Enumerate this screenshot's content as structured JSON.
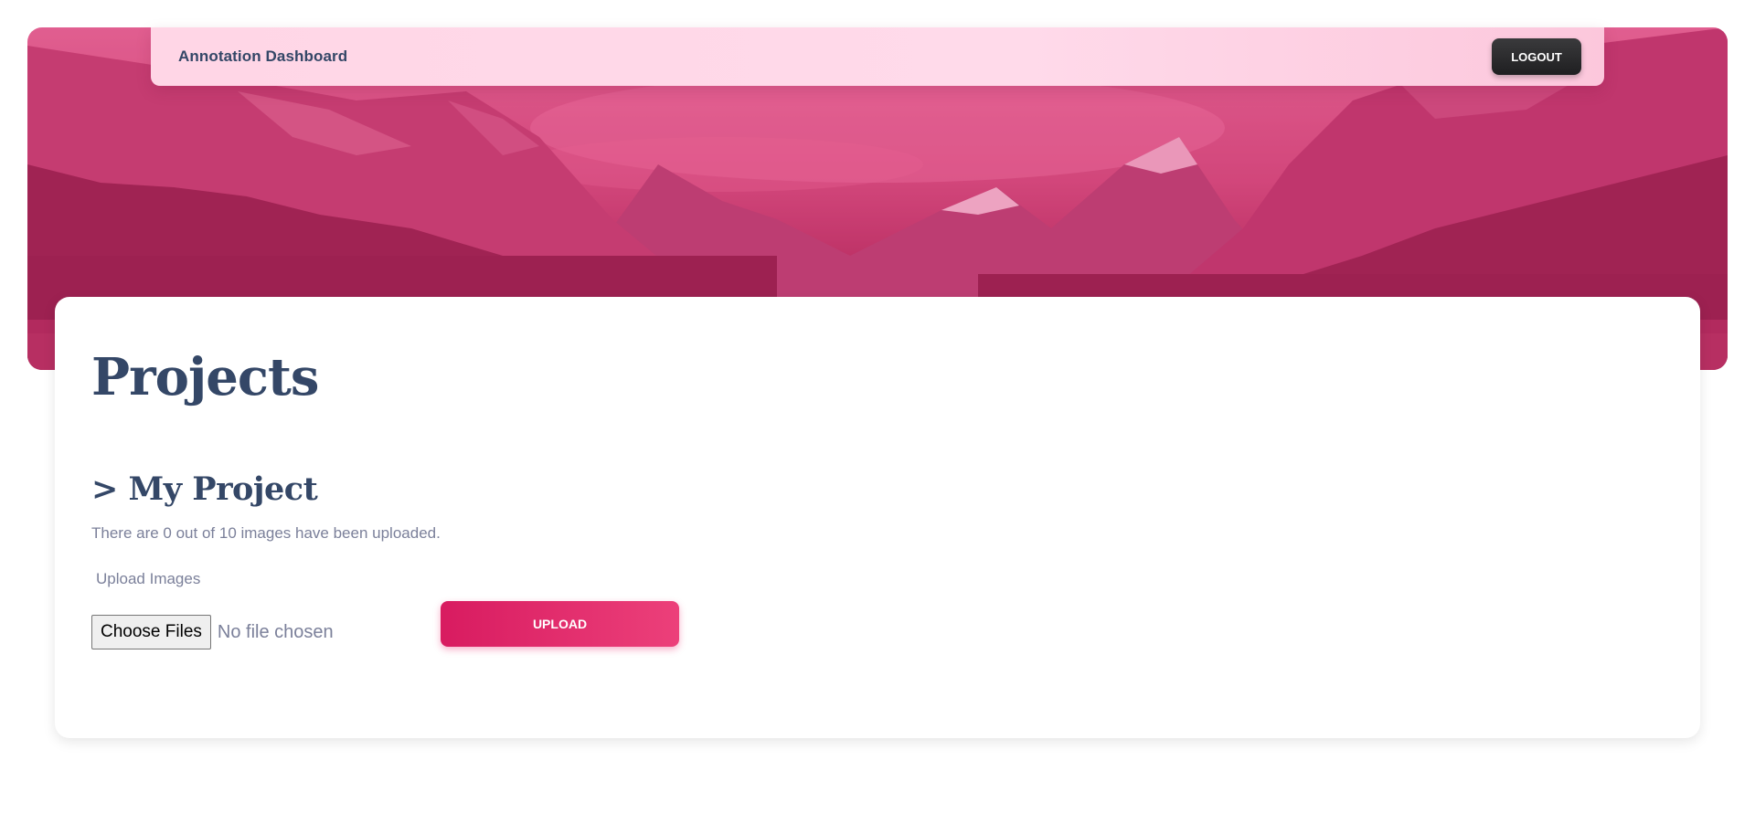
{
  "navbar": {
    "brand": "Annotation Dashboard",
    "logout_label": "LOGOUT"
  },
  "hero": {
    "image": "mountain-lake-landscape",
    "overlay_color": "#d63a76"
  },
  "main": {
    "page_title": "Projects",
    "project": {
      "title": "> My Project",
      "status_text": "There are 0 out of 10 images have been uploaded.",
      "upload_label": "Upload Images",
      "choose_files_label": "Choose Files",
      "file_status": "No file chosen",
      "upload_button_label": "UPLOAD"
    }
  },
  "colors": {
    "accent": "#e91e63",
    "heading": "#344767",
    "muted_text": "#7b809a",
    "dark_button": "#1f1f21"
  }
}
